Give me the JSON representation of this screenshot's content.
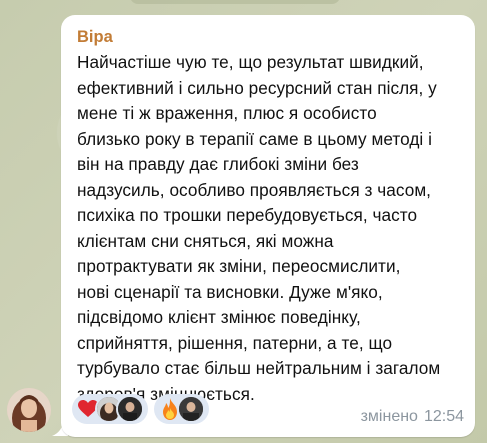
{
  "message": {
    "sender": "Віра",
    "lines": [
      "Найчастіше чую те, що результат швидкий,",
      "ефективний і сильно ресурсний стан після, у",
      "мене ті ж враження, плюс я особисто",
      "близько року в терапії саме в цьому методі і",
      "він на правду дає глибокі зміни без",
      "надзусиль, особливо проявляється з часом,",
      "психіка по трошки перебудовується, часто",
      "клієнтам сни сняться, які можна",
      "протрактувати як зміни, переосмислити,",
      "нові сценарії та висновки. Дуже м'яко,",
      "підсвідомо клієнт змінює поведінку,",
      "сприйняття, рішення, патерни, а те, що",
      "турбувало стає більш нейтральним і загалом",
      "здоров'я зміцнюється."
    ],
    "edited_label": "змінено",
    "time": "12:54"
  },
  "reactions": [
    {
      "icon": "heart-icon",
      "color": "#e0262f"
    },
    {
      "icon": "fire-icon",
      "color": "#f7821b"
    }
  ],
  "colors": {
    "sender_name": "#c27c36",
    "reaction_bg": "#dfe7f3",
    "meta_text": "#8c969f"
  }
}
